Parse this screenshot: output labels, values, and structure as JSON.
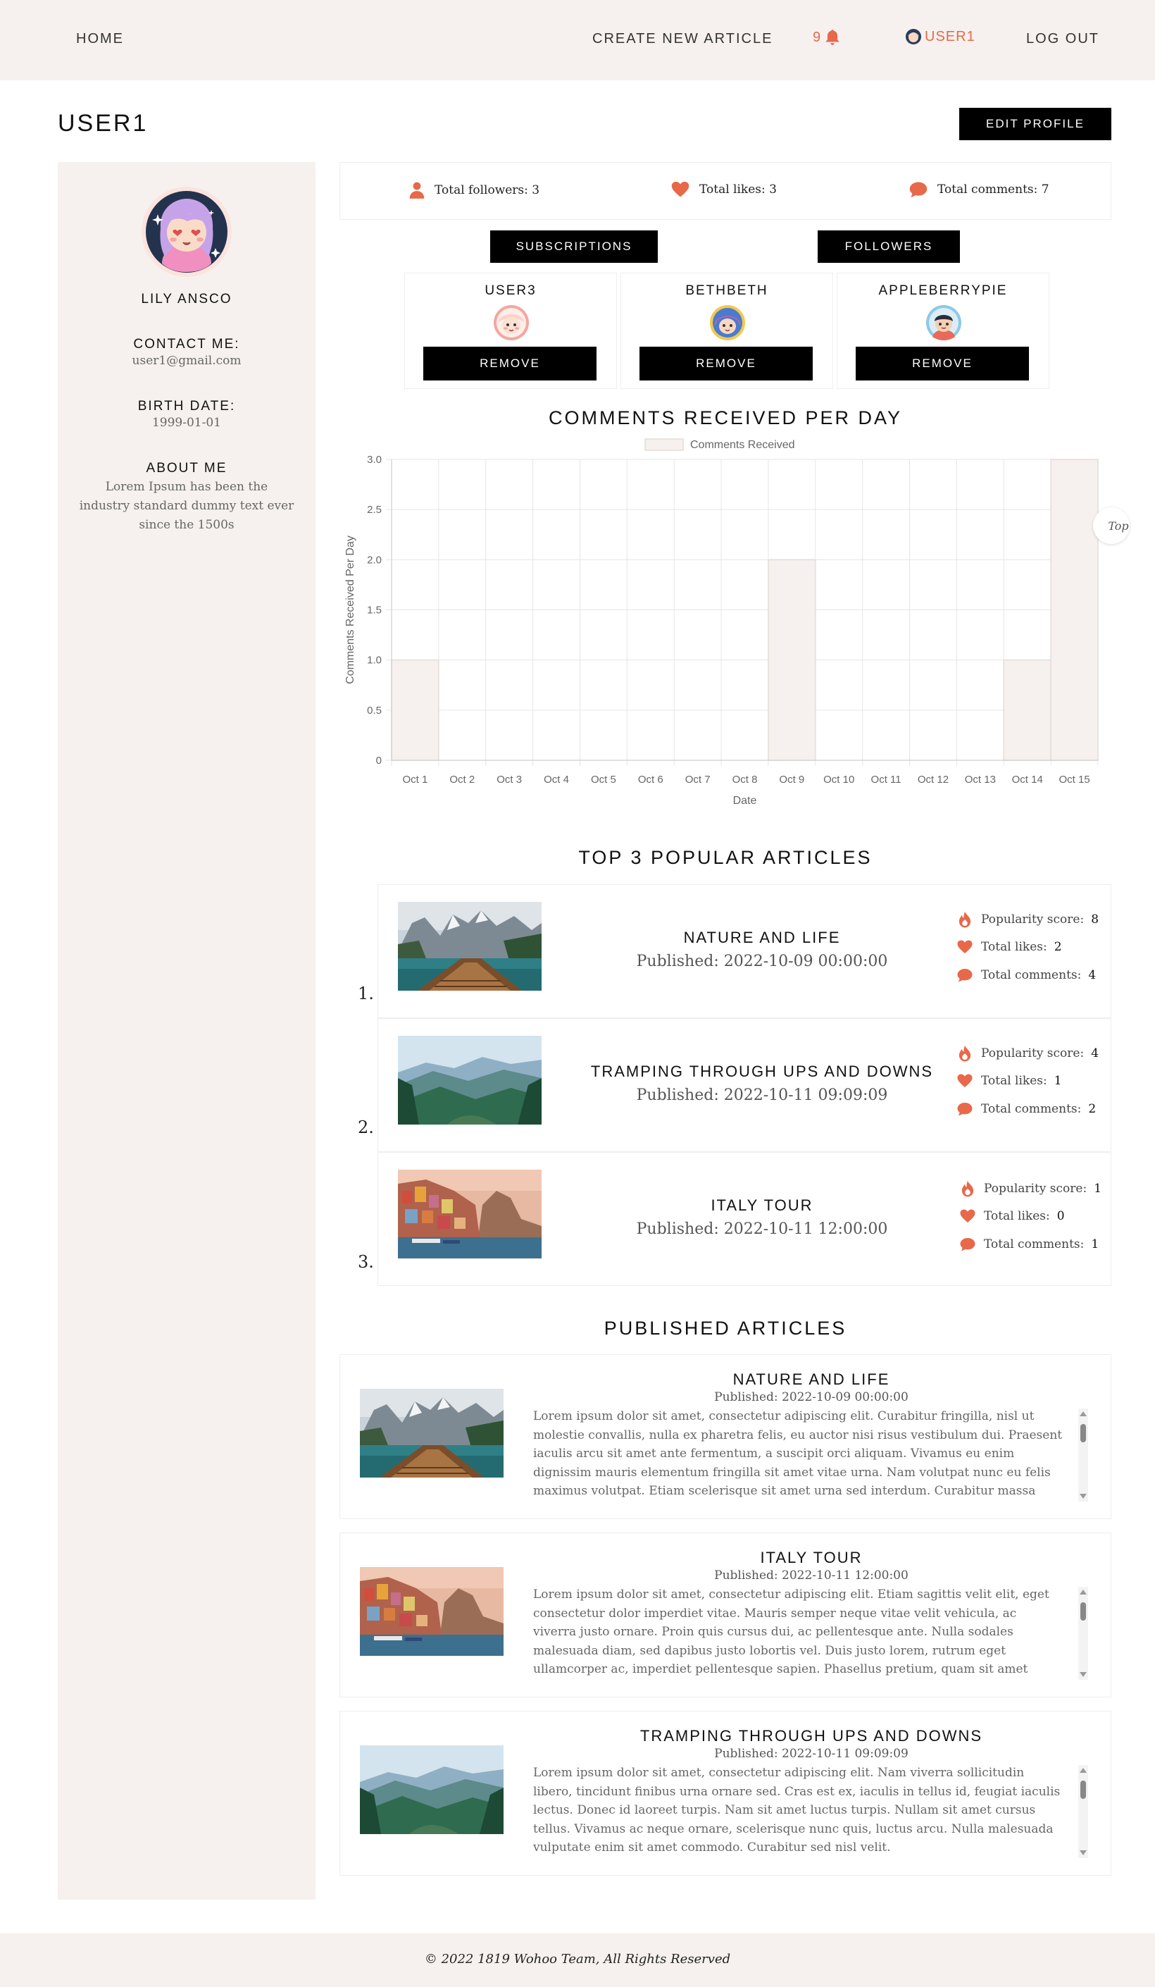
{
  "nav": {
    "home": "HOME",
    "create": "CREATE NEW ARTICLE",
    "notification_count": "9",
    "username": "USER1",
    "logout": "LOG OUT"
  },
  "header": {
    "title": "USER1",
    "edit_profile": "EDIT PROFILE"
  },
  "profile": {
    "name": "LILY ANSCO",
    "contact_label": "CONTACT ME:",
    "email": "user1@gmail.com",
    "birth_label": "BIRTH DATE:",
    "birth_date": "1999-01-01",
    "about_label": "ABOUT ME",
    "about": "Lorem Ipsum has been the industry standard dummy text ever since the 1500s"
  },
  "stats": {
    "followers": "Total followers: 3",
    "likes": "Total likes: 3",
    "comments": "Total comments: 7"
  },
  "tabs": {
    "subscriptions": "SUBSCRIPTIONS",
    "followers": "FOLLOWERS"
  },
  "subscriptions": [
    {
      "name": "USER3",
      "remove": "REMOVE"
    },
    {
      "name": "BETHBETH",
      "remove": "REMOVE"
    },
    {
      "name": "APPLEBERRYPIE",
      "remove": "REMOVE"
    }
  ],
  "chart_title": "COMMENTS RECEIVED PER DAY",
  "chart_data": {
    "type": "bar",
    "title": "COMMENTS RECEIVED PER DAY",
    "categories": [
      "Oct 1",
      "Oct 2",
      "Oct 3",
      "Oct 4",
      "Oct 5",
      "Oct 6",
      "Oct 7",
      "Oct 8",
      "Oct 9",
      "Oct 10",
      "Oct 11",
      "Oct 12",
      "Oct 13",
      "Oct 14",
      "Oct 15"
    ],
    "series": [
      {
        "name": "Comments Received",
        "values": [
          1,
          0,
          0,
          0,
          0,
          0,
          0,
          0,
          2,
          0,
          0,
          0,
          0,
          1,
          3
        ]
      }
    ],
    "xlabel": "Date",
    "ylabel": "Comments Received Per Day",
    "ylim": [
      0,
      3
    ],
    "yticks": [
      "0",
      "0.5",
      "1.0",
      "1.5",
      "2.0",
      "2.5",
      "3.0"
    ],
    "grid": true,
    "legend": "top-center",
    "bar_fill": "#f6f1ee",
    "bar_stroke": "#e5dcd6"
  },
  "top_label": "Top",
  "popular": {
    "title": "TOP 3 POPULAR ARTICLES",
    "items": [
      {
        "rank": "1.",
        "title": "NATURE AND LIFE",
        "published": "Published: 2022-10-09 00:00:00",
        "score_label": "Popularity score:",
        "score": "8",
        "likes_label": "Total likes:",
        "likes": "2",
        "comments_label": "Total comments:",
        "comments": "4"
      },
      {
        "rank": "2.",
        "title": "TRAMPING THROUGH UPS AND DOWNS",
        "published": "Published: 2022-10-11 09:09:09",
        "score_label": "Popularity score:",
        "score": "4",
        "likes_label": "Total likes:",
        "likes": "1",
        "comments_label": "Total comments:",
        "comments": "2"
      },
      {
        "rank": "3.",
        "title": "ITALY TOUR",
        "published": "Published: 2022-10-11 12:00:00",
        "score_label": "Popularity score:",
        "score": "1",
        "likes_label": "Total likes:",
        "likes": "0",
        "comments_label": "Total comments:",
        "comments": "1"
      }
    ]
  },
  "published": {
    "title": "PUBLISHED ARTICLES",
    "items": [
      {
        "title": "NATURE AND LIFE",
        "published": "Published: 2022-10-09 00:00:00",
        "body": "Lorem ipsum dolor sit amet, consectetur adipiscing elit. Curabitur fringilla, nisl ut molestie convallis, nulla ex pharetra felis, eu auctor nisi risus vestibulum dui. Praesent iaculis arcu sit amet ante fermentum, a suscipit orci aliquam. Vivamus eu enim dignissim mauris elementum fringilla sit amet vitae urna. Nam volutpat nunc eu felis maximus volutpat. Etiam scelerisque sit amet urna sed interdum. Curabitur massa neque, rhoncus dictum mi vel, tincidunt"
      },
      {
        "title": "ITALY TOUR",
        "published": "Published: 2022-10-11 12:00:00",
        "body": "Lorem ipsum dolor sit amet, consectetur adipiscing elit. Etiam sagittis velit elit, eget consectetur dolor imperdiet vitae. Mauris semper neque vitae velit vehicula, ac viverra justo ornare. Proin quis cursus dui, ac pellentesque ante. Nulla sodales malesuada diam, sed dapibus justo lobortis vel. Duis justo lorem, rutrum eget ullamcorper ac, imperdiet pellentesque sapien. Phasellus pretium, quam sit amet mattis blandit, felis urna ultricies erat,"
      },
      {
        "title": "TRAMPING THROUGH UPS AND DOWNS",
        "published": "Published: 2022-10-11 09:09:09",
        "body": "Lorem ipsum dolor sit amet, consectetur adipiscing elit. Nam viverra sollicitudin libero, tincidunt finibus urna ornare sed. Cras est ex, iaculis in tellus id, feugiat iaculis lectus. Donec id laoreet turpis. Nam sit amet luctus turpis. Nullam sit amet cursus tellus. Vivamus ac neque ornare, scelerisque nunc quis, luctus arcu. Nulla malesuada vulputate enim sit amet commodo. Curabitur sed nisl velit."
      }
    ]
  },
  "footer": "© 2022 1819 Wohoo Team, All Rights Reserved",
  "colors": {
    "accent": "#e8684a",
    "panel": "#f6f1ee",
    "button": "#000000"
  },
  "icons": [
    "bell-icon",
    "person-icon",
    "heart-icon",
    "speech-bubble-icon",
    "flame-icon",
    "avatar-icon"
  ]
}
